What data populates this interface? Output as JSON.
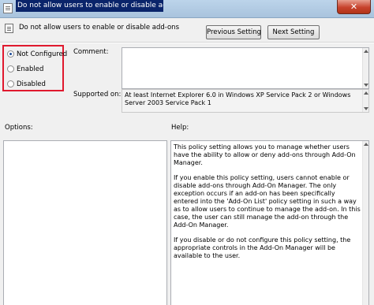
{
  "window": {
    "title": "Do not allow users to enable or disable add-ons",
    "close_label": "✕"
  },
  "header": {
    "policy_name": "Do not allow users to enable or disable add-ons",
    "previous_label": "Previous Setting",
    "next_label": "Next Setting"
  },
  "state": {
    "selected": "Not Configured",
    "options": [
      "Not Configured",
      "Enabled",
      "Disabled"
    ],
    "highlight_color": "#e0192e"
  },
  "labels": {
    "comment": "Comment:",
    "supported_on": "Supported on:",
    "options": "Options:",
    "help": "Help:"
  },
  "comment": {
    "value": ""
  },
  "supported_on": {
    "value": "At least Internet Explorer 6.0 in Windows XP Service Pack 2 or Windows Server 2003 Service Pack 1"
  },
  "help": {
    "paragraphs": [
      "This policy setting allows you to manage whether users have the ability to allow or deny add-ons through Add-On Manager.",
      "If you enable this policy setting, users cannot enable or disable add-ons through Add-On Manager. The only exception occurs if an add-on has been specifically entered into the 'Add-On List' policy setting in such a way as to allow users to continue to manage the add-on. In this case, the user can still manage the add-on through the Add-On Manager.",
      "If you disable or do not configure this policy setting, the appropriate controls in the Add-On Manager will be available to the user."
    ]
  }
}
